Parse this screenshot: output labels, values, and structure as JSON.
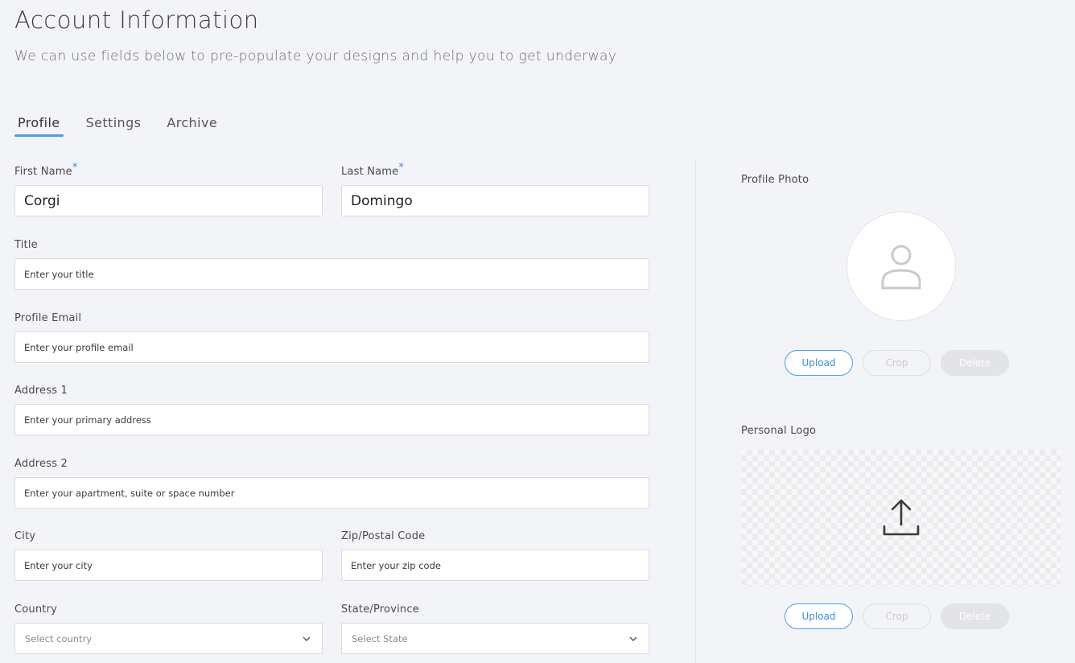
{
  "header": {
    "title": "Account Information",
    "subtitle": "We can use fields below to pre-populate your designs and help you to get underway"
  },
  "tabs": [
    {
      "label": "Profile",
      "active": true
    },
    {
      "label": "Settings",
      "active": false
    },
    {
      "label": "Archive",
      "active": false
    }
  ],
  "form": {
    "first_name": {
      "label": "First Name",
      "required_mark": "*",
      "value": "Corgi"
    },
    "last_name": {
      "label": "Last Name",
      "required_mark": "*",
      "value": "Domingo"
    },
    "title": {
      "label": "Title",
      "placeholder": "Enter your title"
    },
    "profile_email": {
      "label": "Profile Email",
      "placeholder": "Enter your profile email"
    },
    "address1": {
      "label": "Address 1",
      "placeholder": "Enter your primary address"
    },
    "address2": {
      "label": "Address 2",
      "placeholder": "Enter your apartment, suite or space number"
    },
    "city": {
      "label": "City",
      "placeholder": "Enter your city"
    },
    "zip": {
      "label": "Zip/Postal Code",
      "placeholder": "Enter your zip code"
    },
    "country": {
      "label": "Country",
      "placeholder": "Select country"
    },
    "state": {
      "label": "State/Province",
      "placeholder": "Select State"
    }
  },
  "profile_photo": {
    "label": "Profile Photo",
    "icon": "user-avatar-icon",
    "buttons": {
      "upload": "Upload",
      "crop": "Crop",
      "delete": "Delete"
    }
  },
  "personal_logo": {
    "label": "Personal Logo",
    "icon": "upload-arrow-icon",
    "buttons": {
      "upload": "Upload",
      "crop": "Crop",
      "delete": "Delete"
    }
  },
  "colors": {
    "accent": "#4a9eea",
    "background": "#f3f4f8"
  }
}
